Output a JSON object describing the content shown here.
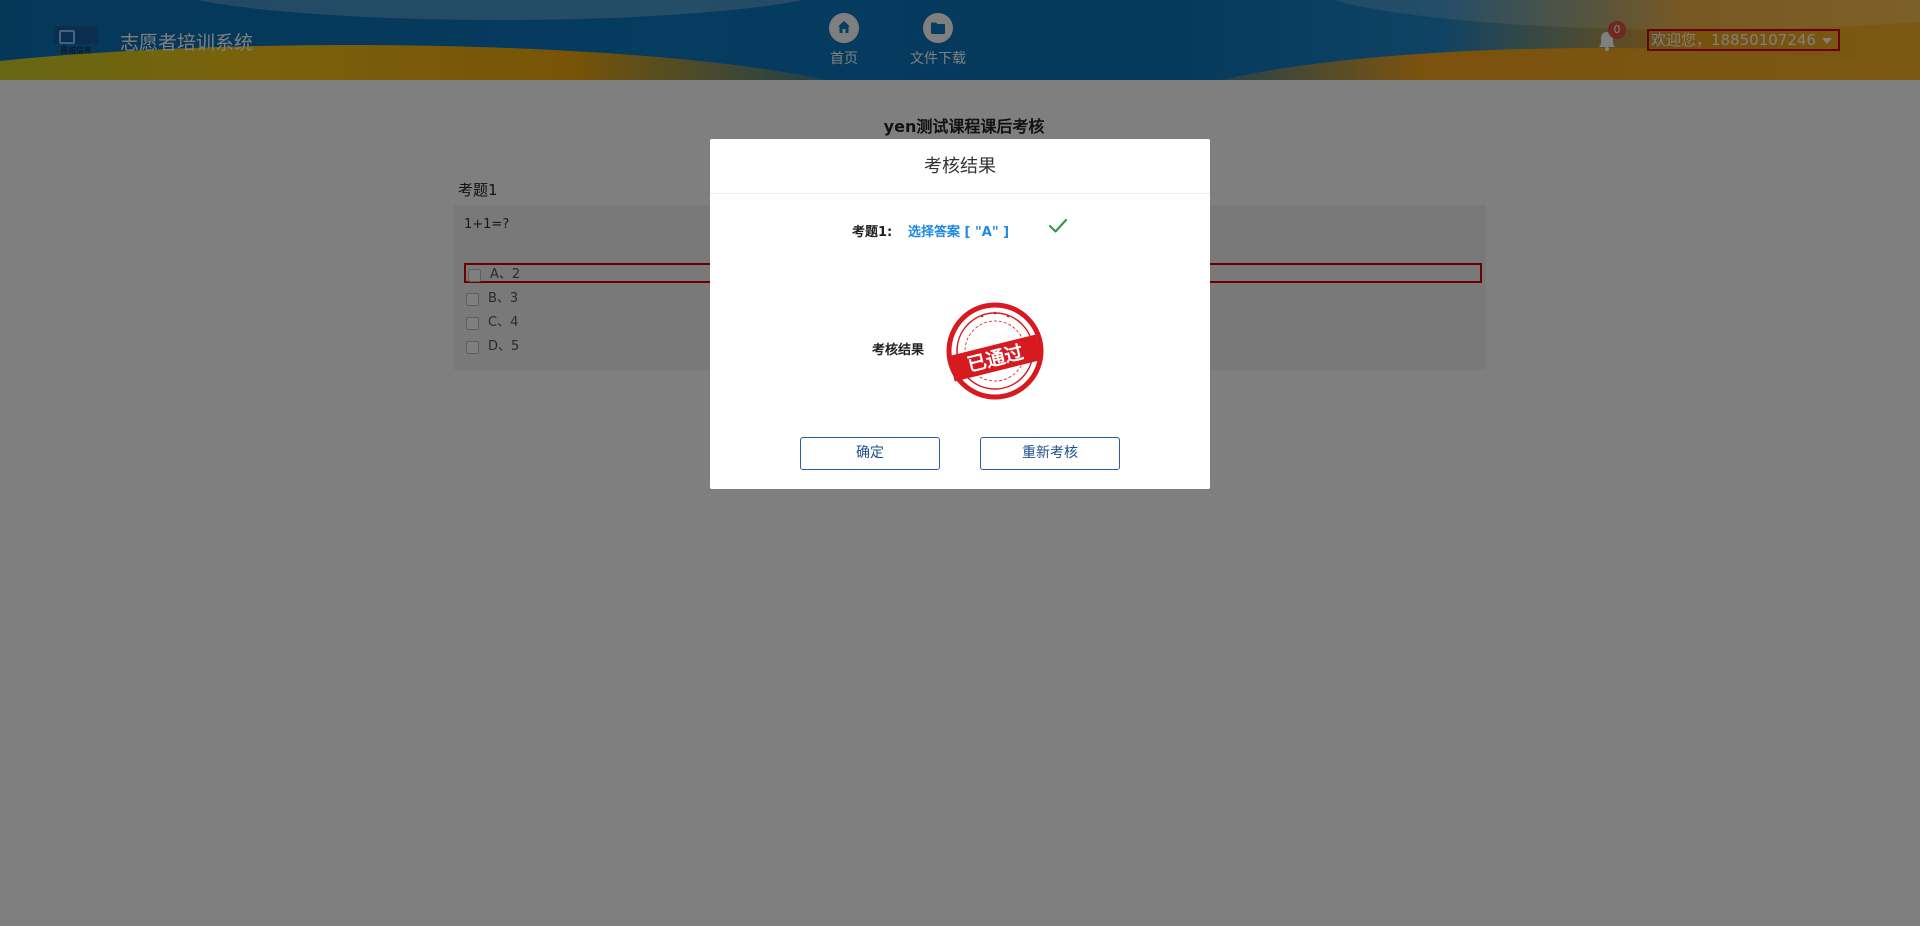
{
  "header": {
    "logo_text": "晋城信息",
    "app_title": "志愿者培训系统",
    "nav": [
      {
        "label": "首页",
        "icon": "home-icon"
      },
      {
        "label": "文件下载",
        "icon": "folder-icon"
      }
    ],
    "notification_count": "0",
    "welcome_text": "欢迎您，18850107246"
  },
  "exam": {
    "title": "yen测试课程课后考核",
    "question_label": "考题1",
    "question_text": "1+1=?",
    "options": [
      "A、2",
      "B、3",
      "C、4",
      "D、5"
    ]
  },
  "modal": {
    "title": "考核结果",
    "answer_label": "考题1:",
    "answer_value": "选择答案 [ \"A\" ]",
    "result_label": "考核结果",
    "stamp_text": "已通过",
    "ok_label": "确定",
    "retry_label": "重新考核"
  },
  "colors": {
    "header_blue": "#0b78bf",
    "accent_link": "#1e88e5",
    "check_green": "#2e9d49",
    "stamp_red": "#d71920",
    "button_border": "#2a5d9e"
  }
}
